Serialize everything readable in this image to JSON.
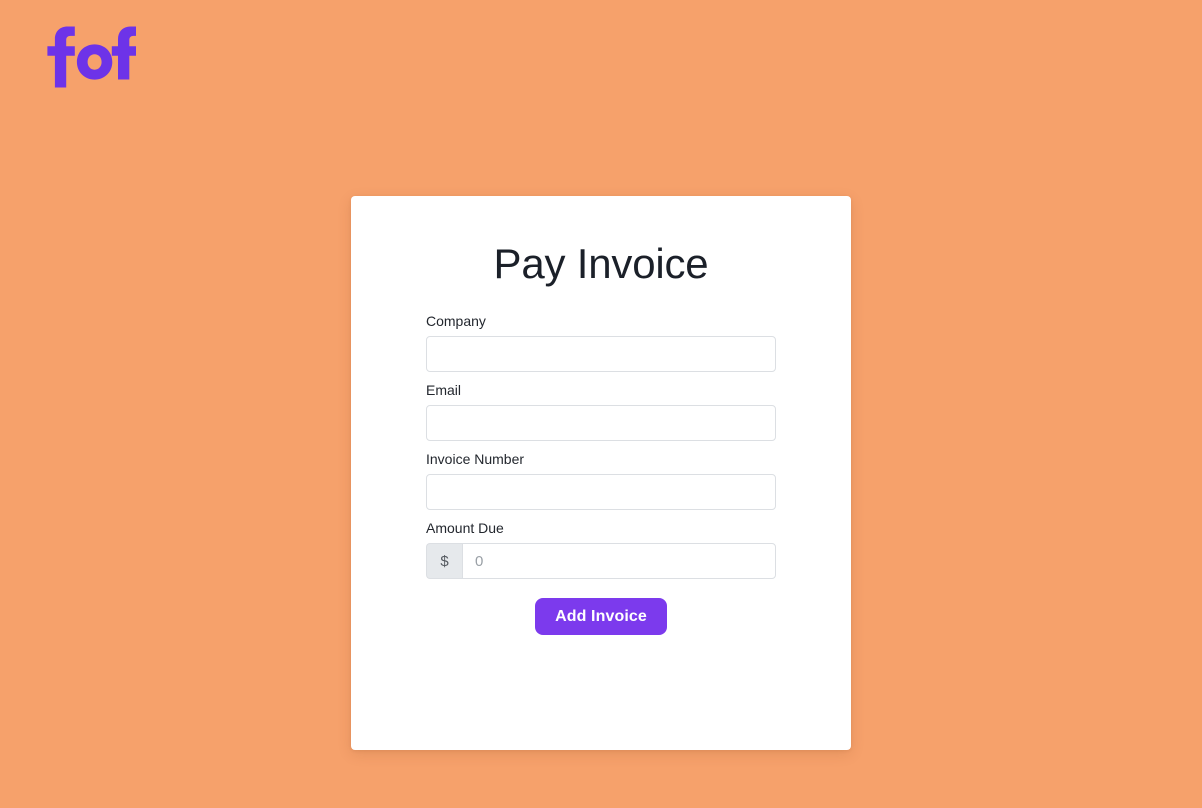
{
  "page": {
    "background_color": "#f6a16b"
  },
  "brand": {
    "logo_text": "fof",
    "logo_color": "#7c3aed"
  },
  "card": {
    "title": "Pay Invoice",
    "background_color": "#ffffff"
  },
  "form": {
    "fields": [
      {
        "label": "Company",
        "value": "",
        "placeholder": ""
      },
      {
        "label": "Email",
        "value": "",
        "placeholder": ""
      },
      {
        "label": "Invoice Number",
        "value": "",
        "placeholder": ""
      },
      {
        "label": "Amount Due",
        "value": "",
        "placeholder": "0",
        "prefix": "$"
      }
    ],
    "submit_label": "Add Invoice",
    "submit_color": "#7c3aed"
  }
}
